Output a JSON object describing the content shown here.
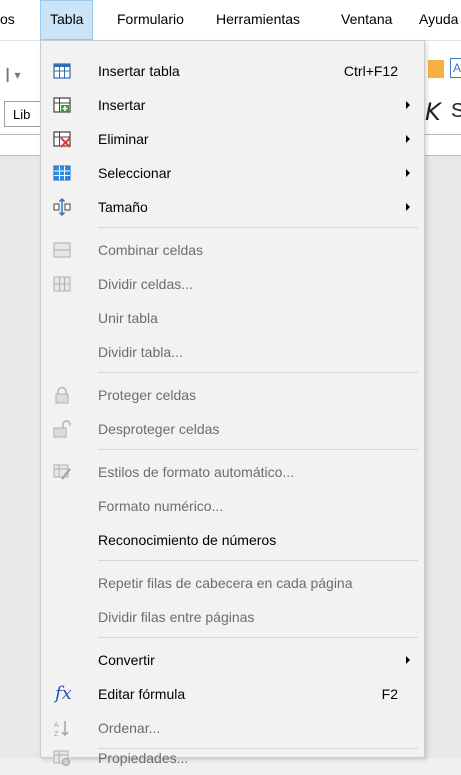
{
  "menubar": {
    "items": [
      {
        "label": "os"
      },
      {
        "label": "Tabla",
        "active": true
      },
      {
        "label": "Formulario"
      },
      {
        "label": "Herramientas"
      },
      {
        "label": "Ventana"
      },
      {
        "label": "Ayuda"
      }
    ]
  },
  "toolbar": {
    "font_fragment": "Lib",
    "right_box_fragment": "A",
    "italic_glyph": "K",
    "underline_fragment": "S"
  },
  "menu": {
    "items": [
      {
        "label": "Insertar tabla",
        "shortcut": "Ctrl+F12",
        "icon": "insert-table-icon",
        "enabled": true,
        "submenu": false
      },
      {
        "label": "Insertar",
        "icon": "insert-rows-icon",
        "enabled": true,
        "submenu": true
      },
      {
        "label": "Eliminar",
        "icon": "delete-table-icon",
        "enabled": true,
        "submenu": true
      },
      {
        "label": "Seleccionar",
        "icon": "select-table-icon",
        "enabled": true,
        "submenu": true
      },
      {
        "label": "Tamaño",
        "icon": "resize-icon",
        "enabled": true,
        "submenu": true
      },
      {
        "label": "Combinar celdas",
        "icon": "merge-cells-icon",
        "enabled": false
      },
      {
        "label": "Dividir celdas...",
        "icon": "split-cells-icon",
        "enabled": false
      },
      {
        "label": "Unir tabla",
        "enabled": false
      },
      {
        "label": "Dividir tabla...",
        "enabled": false
      },
      {
        "label": "Proteger celdas",
        "icon": "lock-icon",
        "enabled": false
      },
      {
        "label": "Desproteger celdas",
        "icon": "unlock-icon",
        "enabled": false
      },
      {
        "label": "Estilos de formato automático...",
        "icon": "autoformat-icon",
        "enabled": false
      },
      {
        "label": "Formato numérico...",
        "enabled": false
      },
      {
        "label": "Reconocimiento de números",
        "enabled": true
      },
      {
        "label": "Repetir filas de cabecera en cada página",
        "enabled": false
      },
      {
        "label": "Dividir filas entre páginas",
        "enabled": false
      },
      {
        "label": "Convertir",
        "enabled": true,
        "submenu": true
      },
      {
        "label": "Editar fórmula",
        "shortcut": "F2",
        "icon": "formula-icon",
        "icon_glyph": "fx",
        "enabled": true
      },
      {
        "label": "Ordenar...",
        "icon": "sort-icon",
        "enabled": false
      },
      {
        "label": "Propiedades...",
        "icon": "table-properties-icon",
        "enabled": false
      }
    ]
  },
  "colors": {
    "accent": "#2a56b5",
    "disabled_text": "#6d6d6d",
    "menubar_active_bg": "#cce4f7",
    "delete_red": "#e03c3c",
    "insert_green": "#3a9a3a",
    "select_blue": "#2f8be6"
  }
}
